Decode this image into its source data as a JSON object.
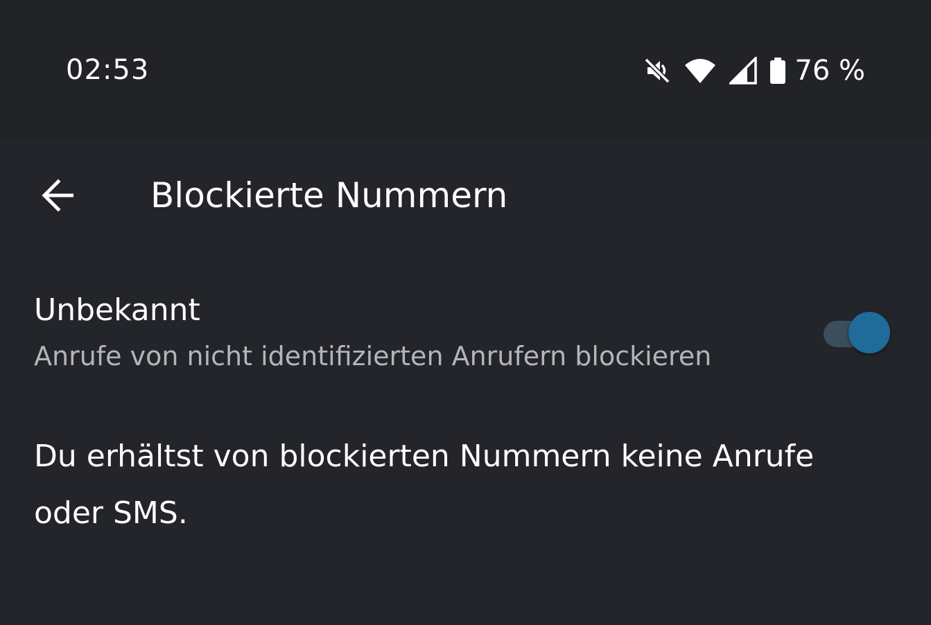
{
  "status_bar": {
    "time": "02:53",
    "icons": [
      "mute-icon",
      "wifi-icon",
      "cell-signal-icon",
      "battery-icon"
    ],
    "battery_percent": "76 %"
  },
  "app_bar": {
    "back_icon": "arrow-back-icon",
    "title": "Blockierte Nummern"
  },
  "setting": {
    "title": "Unbekannt",
    "subtitle": "Anrufe von nicht identifizierten Anrufern blockieren",
    "enabled": true
  },
  "info": {
    "text": "Du erhältst von blockierten Nummern keine Anrufe oder SMS."
  },
  "colors": {
    "background": "#23252b",
    "status_bar": "#222327",
    "toggle_thumb": "#1f6b9a",
    "toggle_track": "#3c4d5c",
    "secondary_text": "#b4b5ba"
  }
}
